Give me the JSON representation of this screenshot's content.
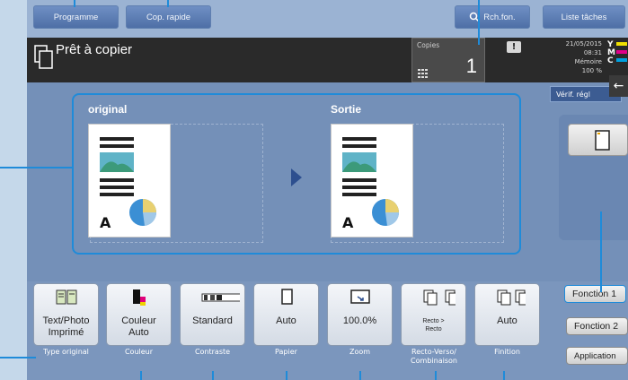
{
  "header": {
    "buttons": [
      {
        "label": "Programme"
      },
      {
        "label": "Cop. rapide"
      },
      {
        "label": "Rch.fon."
      },
      {
        "label": "Liste tâches"
      }
    ]
  },
  "status": {
    "title": "Prêt à copier",
    "copies_label": "Copies",
    "copies_value": "1",
    "warning": "!",
    "date": "21/05/2015",
    "time": "08:31",
    "memory_label": "Mémoire",
    "memory_value": "100 %",
    "toner": [
      "Y",
      "M",
      "C"
    ],
    "verify_label": "Vérif. régl"
  },
  "preview": {
    "original_label": "original",
    "output_label": "Sortie"
  },
  "functions": [
    {
      "value": "Text/Photo\nImprimé",
      "caption": "Type original",
      "icon": "text-photo-icon"
    },
    {
      "value": "Couleur\nAuto",
      "caption": "Couleur",
      "icon": "color-icon"
    },
    {
      "value": "Standard",
      "caption": "Contraste",
      "icon": "density-icon"
    },
    {
      "value": "Auto",
      "caption": "Papier",
      "icon": "paper-icon"
    },
    {
      "value": "100.0%",
      "caption": "Zoom",
      "icon": "zoom-icon"
    },
    {
      "value": "Recto >\nRecto",
      "caption": "Recto-Verso/\nCombinaison",
      "icon": "duplex-icon"
    },
    {
      "value": "Auto",
      "caption": "Finition",
      "icon": "finishing-icon"
    }
  ],
  "side": {
    "f1": "Fonction 1",
    "f2": "Fonction 2",
    "apps": "Application"
  },
  "colors": {
    "accent": "#1f8bd9",
    "panel": "#7490b8",
    "statusbar": "#2a2a2a"
  }
}
